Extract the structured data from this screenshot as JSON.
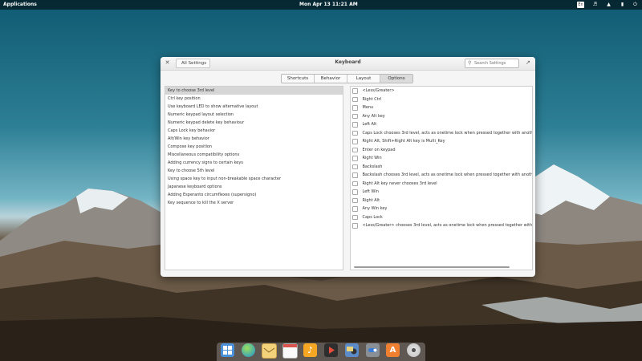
{
  "top_panel": {
    "applications_label": "Applications",
    "clock": "Mon Apr 13    11:21 AM",
    "indicators": [
      "keyboard-layout-icon",
      "volume-icon",
      "network-icon",
      "battery-icon",
      "power-icon"
    ],
    "keyboard_layout": "En"
  },
  "window": {
    "title": "Keyboard",
    "back_label": "All Settings",
    "search_placeholder": "Search Settings",
    "tabs": [
      {
        "label": "Shortcuts",
        "active": false
      },
      {
        "label": "Behavior",
        "active": false
      },
      {
        "label": "Layout",
        "active": false
      },
      {
        "label": "Options",
        "active": true
      }
    ],
    "categories": [
      "Key to choose 3rd level",
      "Ctrl key position",
      "Use keyboard LED to show alternative layout",
      "Numeric keypad layout selection",
      "Numeric keypad delete key behaviour",
      "Caps Lock key behavior",
      "Alt/Win key behavior",
      "Compose key position",
      "Miscellaneous compatibility options",
      "Adding currency signs to certain keys",
      "Key to choose 5th level",
      "Using space key to input non-breakable space character",
      "Japanese keyboard options",
      "Adding Esperanto circumflexes (supersigno)",
      "Key sequence to kill the X server"
    ],
    "selected_category_index": 0,
    "options": [
      "<Less/Greater>",
      "Right Ctrl",
      "Menu",
      "Any Alt key",
      "Left Alt",
      "Caps Lock chooses 3rd level, acts as onetime lock when pressed together with another 3rd-level-chooser",
      "Right Alt, Shift+Right Alt key is Multi_Key",
      "Enter on keypad",
      "Right Win",
      "Backslash",
      "Backslash chooses 3rd level, acts as onetime lock when pressed together with another 3rd-level-chooser",
      "Right Alt key never chooses 3rd level",
      "Left Win",
      "Right Alt",
      "Any Win key",
      "Caps Lock",
      "<Less/Greater> chooses 3rd level, acts as onetime lock when pressed together with another 3rd-level-chooser"
    ]
  },
  "dock": {
    "apps": [
      "multitasking-view-icon",
      "web-browser-icon",
      "mail-icon",
      "calendar-icon",
      "music-icon",
      "videos-icon",
      "photos-icon",
      "system-settings-icon",
      "appcenter-icon",
      "installer-disc-icon"
    ]
  }
}
